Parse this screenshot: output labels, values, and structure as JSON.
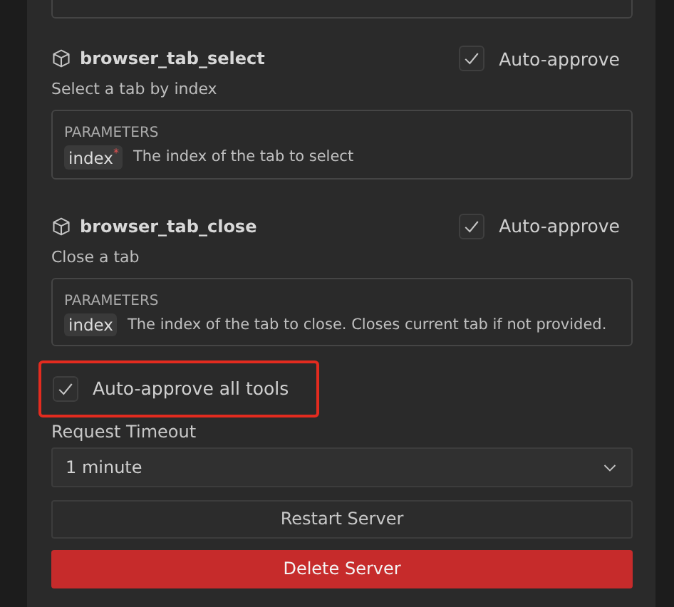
{
  "tools": [
    {
      "name": "browser_tab_select",
      "auto_approve": true,
      "auto_approve_label": "Auto-approve",
      "description": "Select a tab by index",
      "parameters_heading": "PARAMETERS",
      "parameters": [
        {
          "name": "index$^{*}$",
          "description": "The index of the tab to select"
        }
      ]
    },
    {
      "name": "browser_tab_close",
      "auto_approve": true,
      "auto_approve_label": "Auto-approve",
      "description": "Close a tab",
      "parameters_heading": "PARAMETERS",
      "parameters": [
        {
          "name": "index",
          "description": "The index of the tab to close. Closes current tab if not provided."
        }
      ]
    }
  ],
  "auto_approve_all": {
    "label": "Auto-approve all tools",
    "checked": true,
    "highlighted": true
  },
  "request_timeout": {
    "label": "Request Timeout",
    "value": "1 minute"
  },
  "buttons": [
    {
      "kind": "secondary",
      "label": "Restart Server"
    },
    {
      "kind": "danger",
      "label": "Delete Server"
    }
  ]
}
